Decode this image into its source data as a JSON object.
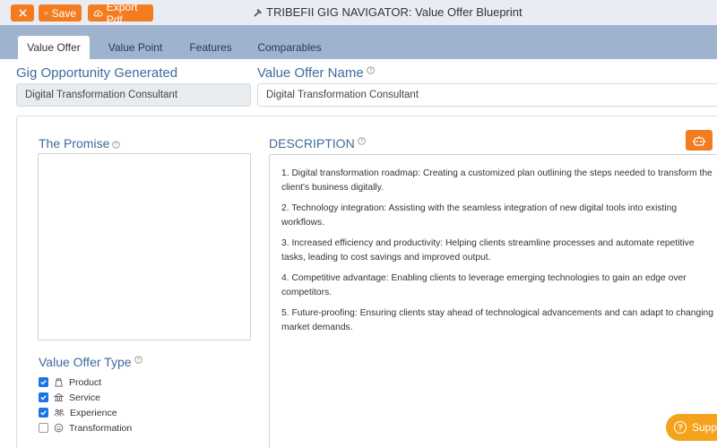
{
  "toolbar": {
    "close_icon": "close-icon",
    "save_label": "Save",
    "export_label": "Export Pdf",
    "title": "TRIBEFII GIG NAVIGATOR: Value Offer Blueprint",
    "accent_color": "#f47c20"
  },
  "tabs": [
    {
      "label": "Value Offer",
      "active": true
    },
    {
      "label": "Value Point",
      "active": false
    },
    {
      "label": "Features",
      "active": false
    },
    {
      "label": "Comparables",
      "active": false
    }
  ],
  "gig_opportunity": {
    "label": "Gig Opportunity Generated",
    "value": "Digital Transformation Consultant"
  },
  "value_offer_name": {
    "label": "Value Offer Name",
    "value": "Digital Transformation Consultant"
  },
  "promise": {
    "label": "The Promise",
    "value": ""
  },
  "description": {
    "label": "DESCRIPTION",
    "paragraphs": [
      "1. Digital transformation roadmap: Creating a customized plan outlining the steps needed to transform the client's business digitally.",
      "2. Technology integration: Assisting with the seamless integration of new digital tools into existing workflows.",
      "3. Increased efficiency and productivity: Helping clients streamline processes and automate repetitive tasks, leading to cost savings and improved output.",
      "4. Competitive advantage: Enabling clients to leverage emerging technologies to gain an edge over competitors.",
      "5. Future-proofing: Ensuring clients stay ahead of technological advancements and can adapt to changing market demands."
    ]
  },
  "value_offer_type": {
    "label": "Value Offer Type",
    "options": [
      {
        "label": "Product",
        "checked": true,
        "icon": "product-icon"
      },
      {
        "label": "Service",
        "checked": true,
        "icon": "service-icon"
      },
      {
        "label": "Experience",
        "checked": true,
        "icon": "experience-icon"
      },
      {
        "label": "Transformation",
        "checked": false,
        "icon": "transformation-icon"
      }
    ]
  },
  "support": {
    "label": "Supp"
  }
}
